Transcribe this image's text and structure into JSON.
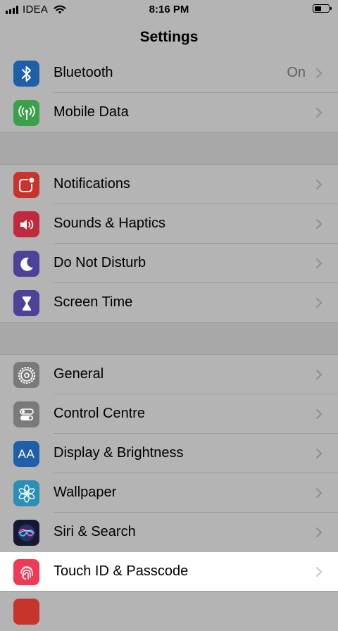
{
  "status_bar": {
    "carrier": "IDEA",
    "time": "8:16 PM",
    "battery_level": 0.55
  },
  "nav": {
    "title": "Settings"
  },
  "colors": {
    "bluetooth": "#1f5fa8",
    "mobile_data": "#3aa04a",
    "notifications": "#c8332b",
    "sounds": "#c1293d",
    "dnd": "#4c4398",
    "screen_time": "#4c4398",
    "general": "#7a7a7a",
    "control_centre": "#7a7a7a",
    "display": "#1f5fa8",
    "wallpaper": "#2a8fb5",
    "siri": "#151830",
    "touch_id": "#ef3a57"
  },
  "rows": {
    "bluetooth": {
      "label": "Bluetooth",
      "value": "On",
      "icon": "bluetooth-icon"
    },
    "mobile_data": {
      "label": "Mobile Data",
      "icon": "antenna-icon"
    },
    "notifications": {
      "label": "Notifications",
      "icon": "notifications-icon"
    },
    "sounds": {
      "label": "Sounds & Haptics",
      "icon": "speaker-icon"
    },
    "dnd": {
      "label": "Do Not Disturb",
      "icon": "moon-icon"
    },
    "screen_time": {
      "label": "Screen Time",
      "icon": "hourglass-icon"
    },
    "general": {
      "label": "General",
      "icon": "gear-icon"
    },
    "control_centre": {
      "label": "Control Centre",
      "icon": "toggles-icon"
    },
    "display": {
      "label": "Display & Brightness",
      "icon": "text-size-icon",
      "icon_text": "AA"
    },
    "wallpaper": {
      "label": "Wallpaper",
      "icon": "flower-icon"
    },
    "siri": {
      "label": "Siri & Search",
      "icon": "siri-icon"
    },
    "touch_id": {
      "label": "Touch ID & Passcode",
      "icon": "fingerprint-icon"
    }
  }
}
